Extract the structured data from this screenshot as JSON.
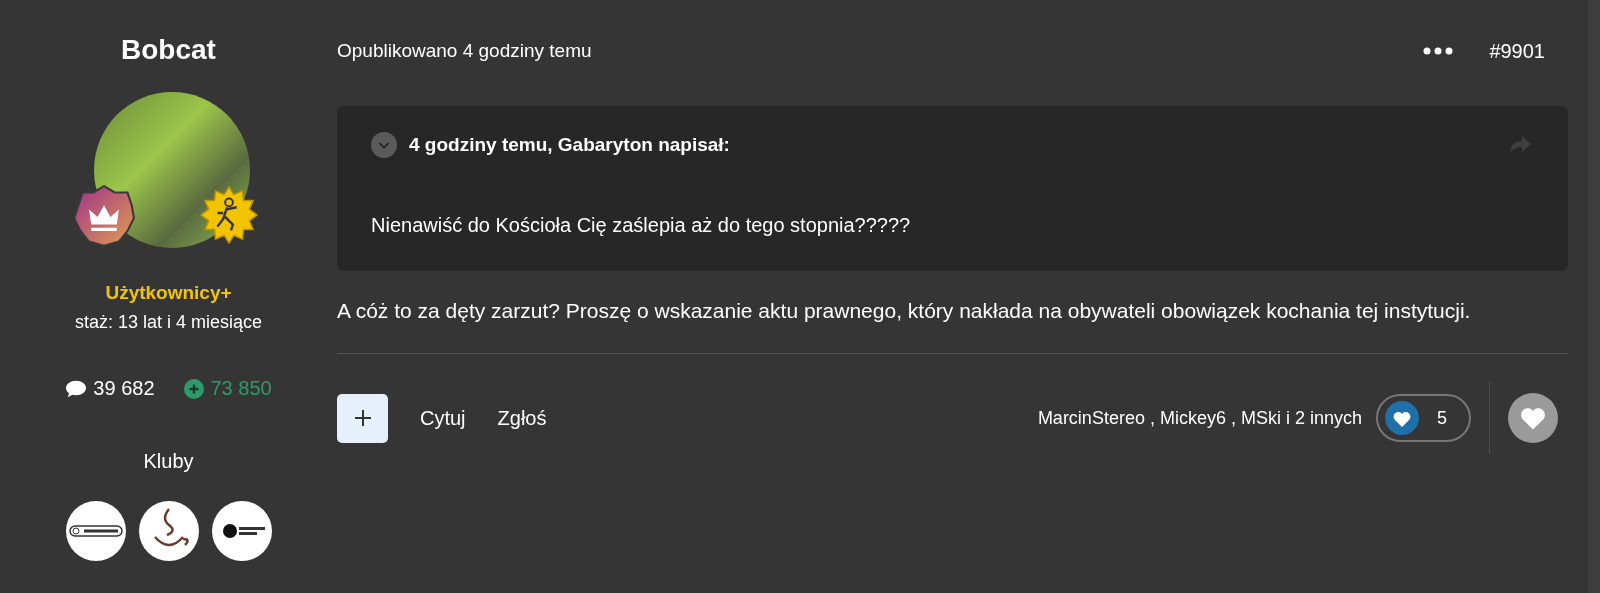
{
  "author": {
    "name": "Bobcat",
    "group": "Użytkownicy+",
    "tenure": "staż: 13 lat i 4 miesiące",
    "posts": "39 682",
    "reputation": "73 850",
    "clubs_label": "Kluby",
    "clubs": [
      {
        "kind": "speaker"
      },
      {
        "kind": "cup"
      },
      {
        "kind": "disc"
      }
    ]
  },
  "post": {
    "published": "Opublikowano 4 godziny temu",
    "number": "#9901",
    "quote": {
      "citation": "4 godziny temu, Gabaryton napisał:",
      "text": "Nienawiść do Kościoła Cię zaślepia aż do tego stopnia?????"
    },
    "body": "A cóż to za dęty zarzut? Proszę o wskazanie aktu prawnego, który nakłada na obywateli obowiązek kochania tej instytucji.",
    "actions": [
      "Cytuj",
      "Zgłoś"
    ],
    "reacted_by": "MarcinStereo , Mickey6 , MSki i 2 innych",
    "reaction_count": "5"
  }
}
